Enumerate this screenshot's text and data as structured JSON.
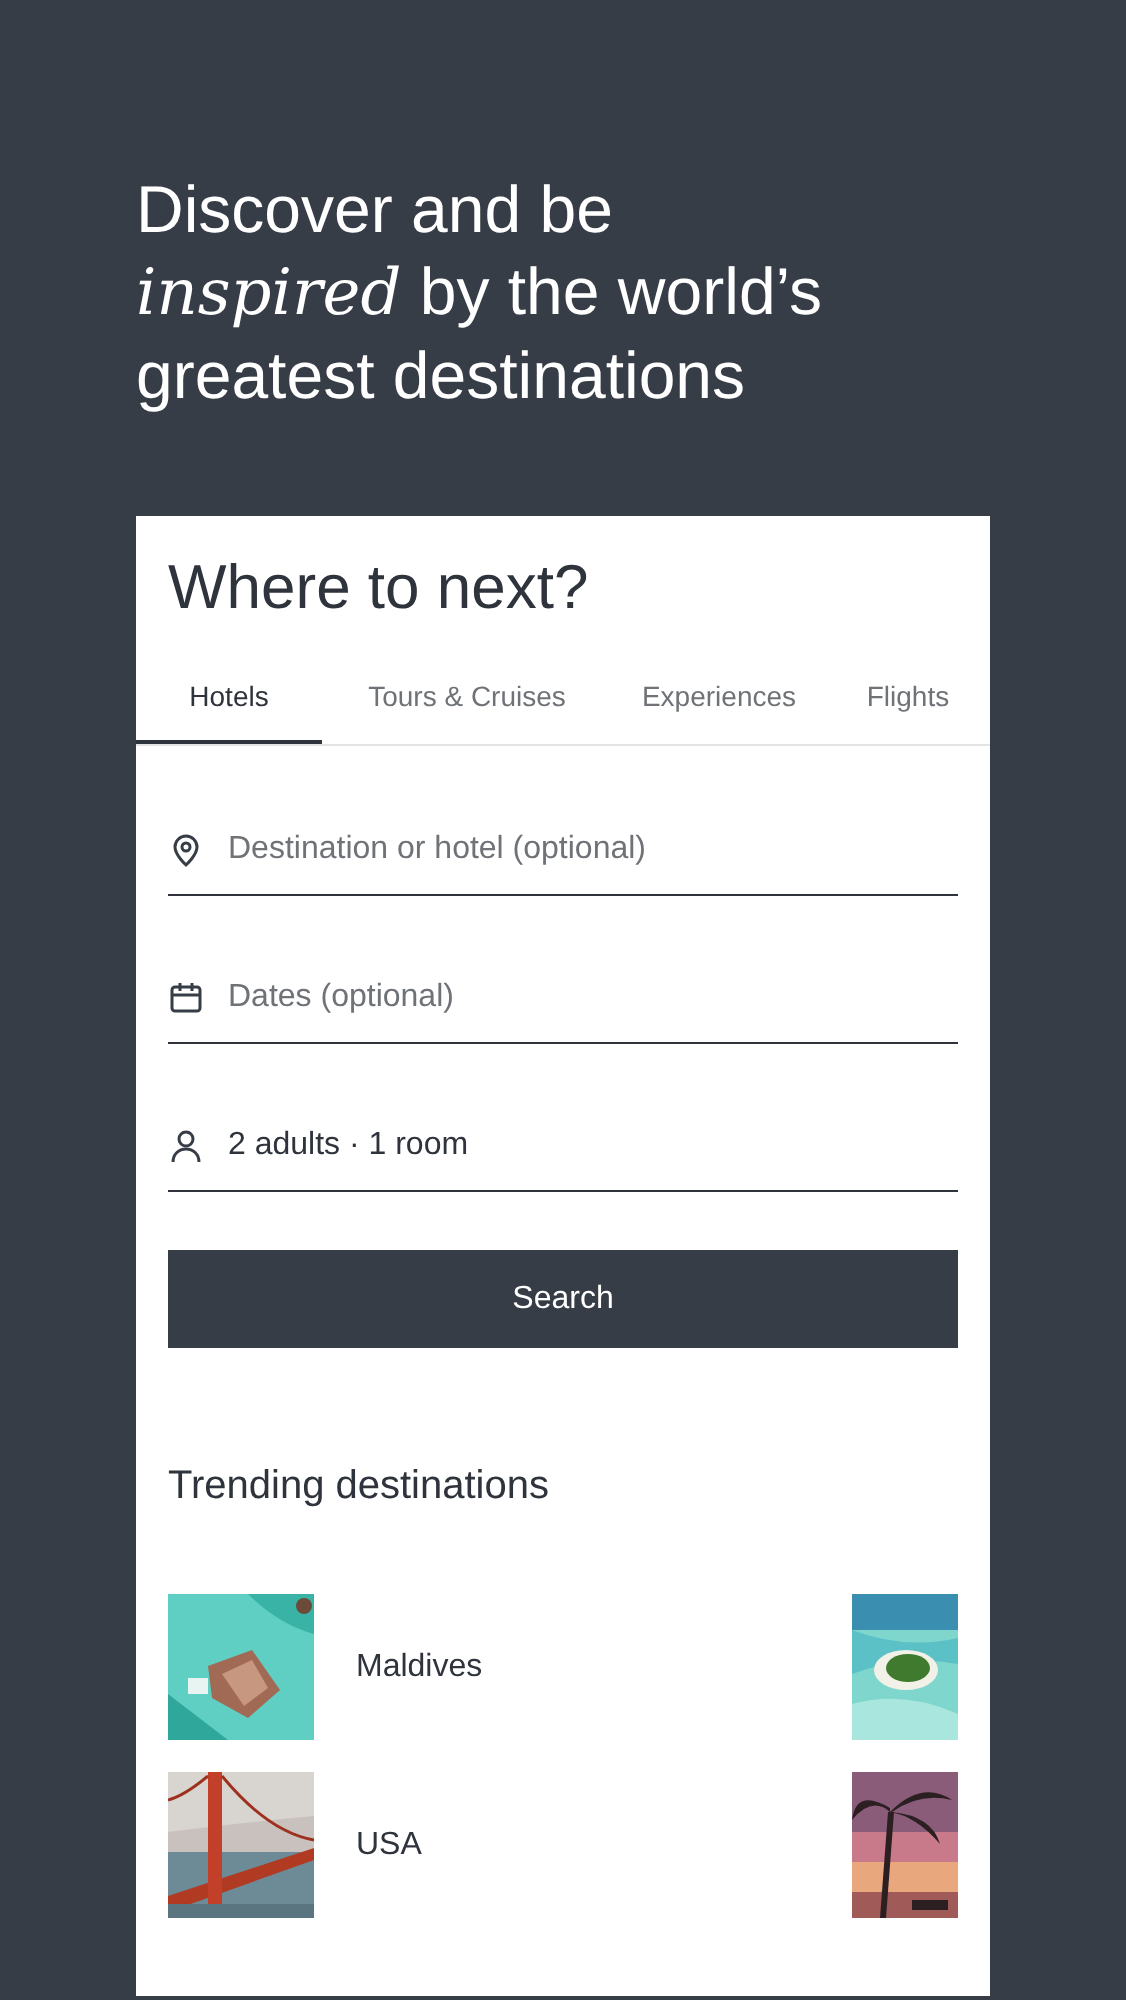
{
  "headline_lines": [
    "Discover and be",
    "*inspired* by the world’s",
    "greatest destinations"
  ],
  "card": {
    "title": "Where to next?",
    "tabs": [
      {
        "label": "Hotels",
        "selected": true
      },
      {
        "label": "Tours & Cruises",
        "selected": false
      },
      {
        "label": "Experiences",
        "selected": false
      },
      {
        "label": "Flights",
        "selected": false
      }
    ],
    "fields": [
      {
        "kind": "location",
        "placeholder": "Destination or hotel (optional)"
      },
      {
        "kind": "dates",
        "placeholder": "Dates (optional)"
      },
      {
        "kind": "guests",
        "value": "2 adults · 1 room"
      }
    ],
    "search_button": "Search",
    "trending": {
      "title": "Trending destinations",
      "items": [
        {
          "name": "Maldives",
          "kind": "picture"
        },
        {
          "name": "USA",
          "kind": "picture"
        }
      ]
    }
  }
}
